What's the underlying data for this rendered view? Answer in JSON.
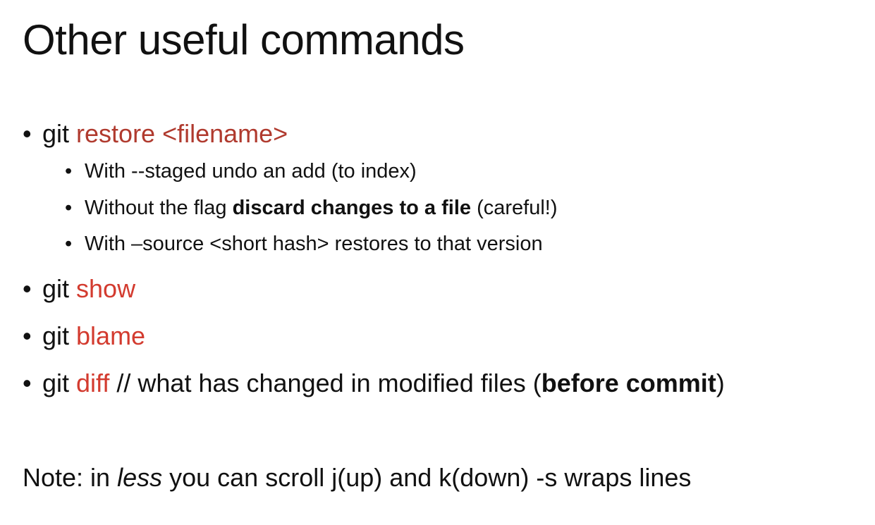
{
  "slide": {
    "title": "Other useful commands",
    "bullet": "•",
    "items": [
      {
        "prefix": "git ",
        "command": "restore <filename>",
        "subitems": [
          {
            "text": "With --staged undo an add (to index)"
          },
          {
            "before": "Without the flag ",
            "bold": "discard changes to a file",
            "after": " (careful!)"
          },
          {
            "text": "With –source <short hash> restores to that version"
          }
        ]
      },
      {
        "prefix": "git ",
        "command": "show"
      },
      {
        "prefix": "git ",
        "command": "blame"
      },
      {
        "prefix": "git ",
        "command": "diff",
        "suffix": " // what has changed in modified files (",
        "bold": "before commit",
        "close": ")"
      }
    ],
    "note": {
      "before": "Note: in ",
      "italic": "less",
      "after": " you can scroll j(up) and k(down)  -s wraps lines"
    }
  }
}
